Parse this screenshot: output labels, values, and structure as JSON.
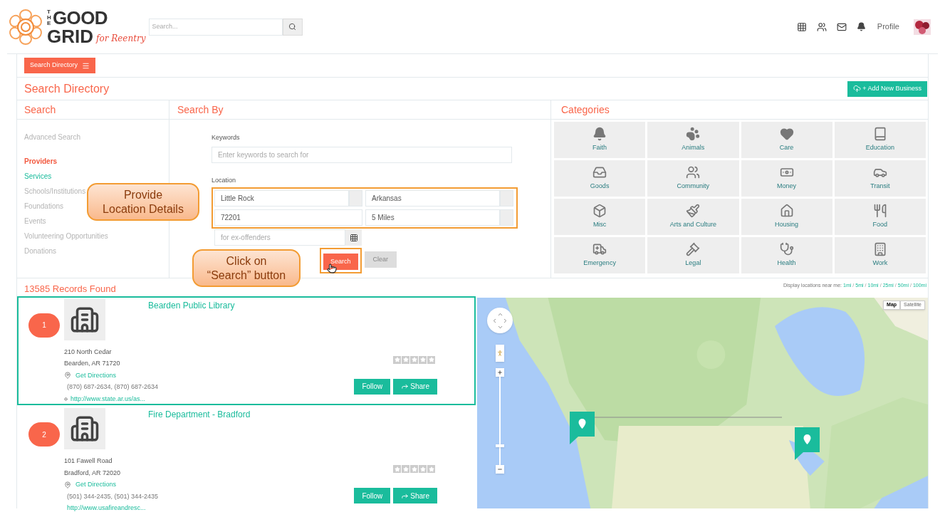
{
  "logo": {
    "top": "THE",
    "main": "GOOD",
    "bottom": "GRID",
    "tagline": "for Reentry"
  },
  "header": {
    "search_placeholder": "Search...",
    "profile": "Profile"
  },
  "toolbar": {
    "button": "Search Directory"
  },
  "page": {
    "title": "Search Directory",
    "add_button": "+ Add New Business"
  },
  "search_panel": {
    "title": "Search",
    "items": [
      {
        "label": "Advanced Search",
        "kind": "muted"
      },
      {
        "label": "Providers",
        "kind": "active"
      },
      {
        "label": "Services",
        "kind": "link"
      },
      {
        "label": "Schools/Institutions",
        "kind": "muted"
      },
      {
        "label": "Foundations",
        "kind": "muted"
      },
      {
        "label": "Events",
        "kind": "muted"
      },
      {
        "label": "Volunteering Opportunities",
        "kind": "muted"
      },
      {
        "label": "Donations",
        "kind": "muted"
      }
    ]
  },
  "search_by": {
    "title": "Search By",
    "keywords_label": "Keywords",
    "keywords_placeholder": "Enter keywords to search for",
    "location_label": "Location",
    "city": "Little Rock",
    "state": "Arkansas",
    "zip": "72201",
    "radius": "5 Miles",
    "tag_placeholder": "for ex-offenders",
    "search_button": "Search",
    "clear_button": "Clear"
  },
  "categories": {
    "title": "Categories",
    "items": [
      "Faith",
      "Animals",
      "Care",
      "Education",
      "Goods",
      "Community",
      "Money",
      "Transit",
      "Misc",
      "Arts and Culture",
      "Housing",
      "Food",
      "Emergency",
      "Legal",
      "Health",
      "Work"
    ]
  },
  "results": {
    "count": "13585 Records Found",
    "records": [
      {
        "number": "1",
        "name": "Bearden Public Library",
        "address": [
          "210 North Cedar",
          "Bearden, AR 71720"
        ],
        "directions": "Get Directions",
        "phone": "(870) 687-2634, (870) 687-2634",
        "url": "http://www.state.ar.us/as...",
        "stars": 0,
        "follow": "Follow",
        "share": "Share",
        "selected": true
      },
      {
        "number": "2",
        "name": "Fire Department - Bradford",
        "address": [
          "101 Fawell Road",
          "Bradford, AR 72020"
        ],
        "directions": "Get Directions",
        "phone": "(501) 344-2435, (501) 344-2435",
        "url": "http://www.usafireandresc...",
        "stars": 0,
        "follow": "Follow",
        "share": "Share",
        "selected": false
      }
    ]
  },
  "map": {
    "near_label": "Display locations near me:",
    "distances": [
      "1mi",
      "5mi",
      "10mi",
      "25mi",
      "50mi",
      "100mi"
    ],
    "separator": "/",
    "zoom": {
      "level": 0.2
    },
    "type_buttons": [
      {
        "label": "Map",
        "selected": true
      },
      {
        "label": "Satellite",
        "selected": false
      }
    ]
  },
  "callouts": [
    {
      "lines": [
        "Provide",
        "Location Details"
      ]
    },
    {
      "lines": [
        "Click on",
        "“Search” button"
      ]
    }
  ]
}
